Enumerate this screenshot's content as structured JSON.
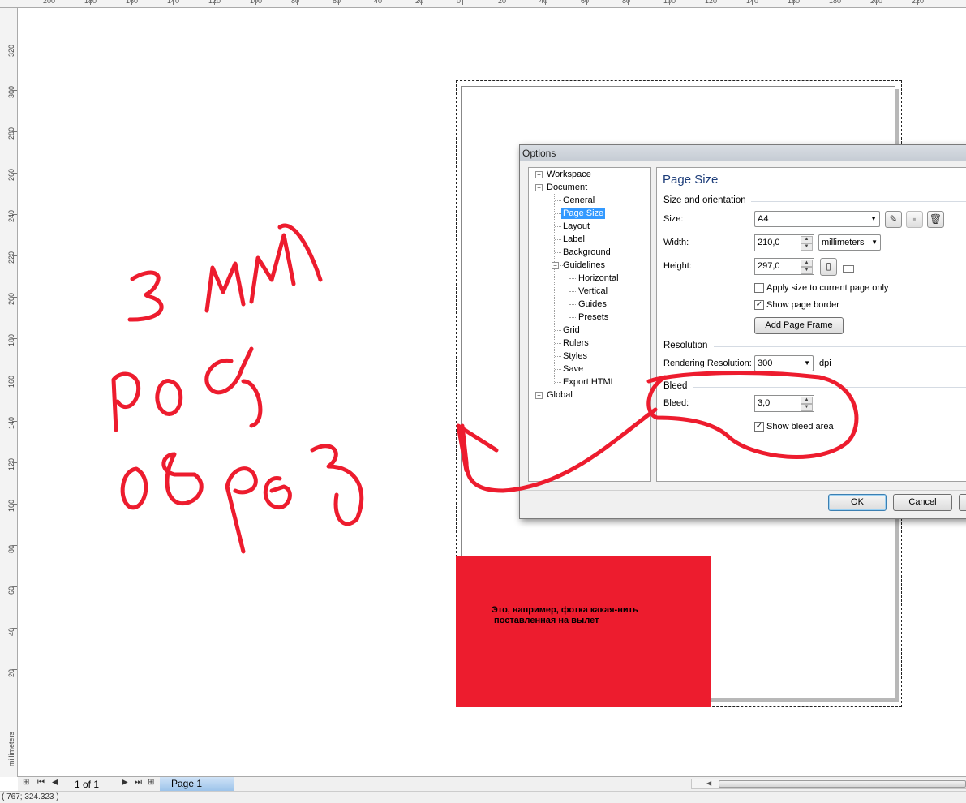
{
  "ruler": {
    "top_labels": [
      "200",
      "180",
      "160",
      "140",
      "120",
      "100",
      "80",
      "60",
      "40",
      "20",
      "0",
      "20",
      "40",
      "60",
      "80",
      "100",
      "120",
      "140",
      "160",
      "180",
      "200",
      "220"
    ],
    "side_labels": [
      "320",
      "300",
      "280",
      "260",
      "240",
      "220",
      "200",
      "180",
      "160",
      "140",
      "120",
      "100",
      "80",
      "60",
      "40",
      "20"
    ],
    "unit": "millimeters"
  },
  "canvas": {
    "photo_text": "Это, например, фотка какая-нить\n поставленная на вылет"
  },
  "dialog": {
    "title": "Options",
    "tree": {
      "workspace": "Workspace",
      "document": "Document",
      "general": "General",
      "page_size": "Page Size",
      "layout": "Layout",
      "label": "Label",
      "background": "Background",
      "guidelines": "Guidelines",
      "horizontal": "Horizontal",
      "vertical": "Vertical",
      "guides": "Guides",
      "presets": "Presets",
      "grid": "Grid",
      "rulers": "Rulers",
      "styles": "Styles",
      "save": "Save",
      "export_html": "Export HTML",
      "global": "Global"
    },
    "panel": {
      "title": "Page Size",
      "size_orientation": "Size and orientation",
      "size_label": "Size:",
      "size_value": "A4",
      "width_label": "Width:",
      "width_value": "210,0",
      "units_value": "millimeters",
      "height_label": "Height:",
      "height_value": "297,0",
      "apply_current": "Apply size to current page only",
      "apply_current_checked": false,
      "show_border": "Show page border",
      "show_border_checked": true,
      "add_frame": "Add Page Frame",
      "resolution_section": "Resolution",
      "render_label": "Rendering Resolution:",
      "render_value": "300",
      "dpi": "dpi",
      "bleed_section": "Bleed",
      "bleed_label": "Bleed:",
      "bleed_value": "3,0",
      "show_bleed": "Show bleed area",
      "show_bleed_checked": true
    },
    "ok": "OK",
    "cancel": "Cancel"
  },
  "bottom": {
    "page_count": "1 of 1",
    "page_tab": "Page 1"
  },
  "status": {
    "coords": "( 767; 324.323 )"
  },
  "annotations": {
    "color": "#ed1c2e",
    "handwriting": "3 мм под обрез"
  }
}
